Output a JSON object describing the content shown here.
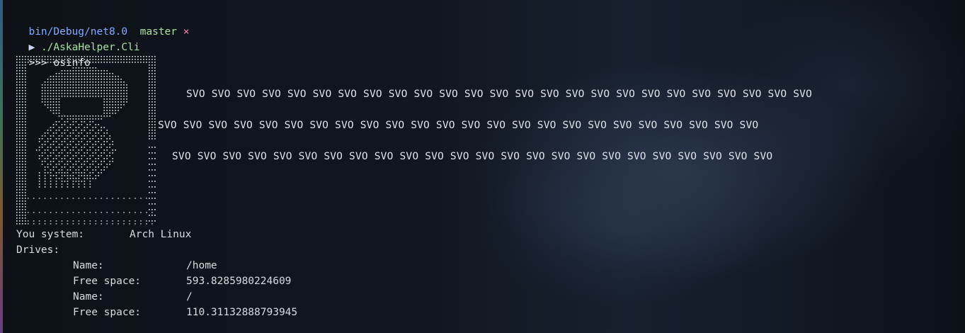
{
  "prompt": {
    "path": "bin/Debug/net8.0",
    "branch": "master",
    "dirty_mark": "×",
    "arrow": "▶",
    "command": "./AskaHelper.Cli"
  },
  "repl": {
    "prompt": ">>>",
    "command": "osinfo"
  },
  "svo_lines": [
    "SVO SVO SVO SVO SVO SVO SVO SVO SVO SVO SVO SVO SVO SVO SVO SVO SVO SVO SVO SVO SVO SVO SVO SVO SVO",
    "SVO SVO SVO SVO SVO SVO SVO SVO SVO SVO SVO SVO SVO SVO SVO SVO SVO SVO SVO SVO SVO SVO SVO SVO",
    "SVO SVO SVO SVO SVO SVO SVO SVO SVO SVO SVO SVO SVO SVO SVO SVO SVO SVO SVO SVO SVO SVO SVO SVO"
  ],
  "system": {
    "label": "You system:",
    "value": "Arch Linux"
  },
  "drives": {
    "label": "Drives:",
    "items": [
      {
        "name_label": "Name:",
        "name": "/home",
        "space_label": "Free space:",
        "space": "593.8285980224609"
      },
      {
        "name_label": "Name:",
        "name": "/",
        "space_label": "Free space:",
        "space": "110.31132888793945"
      }
    ]
  },
  "colors": {
    "path": "#82aaff",
    "branch": "#a6e3a1",
    "dirty": "#f38ba8",
    "text": "#d4d7de"
  }
}
